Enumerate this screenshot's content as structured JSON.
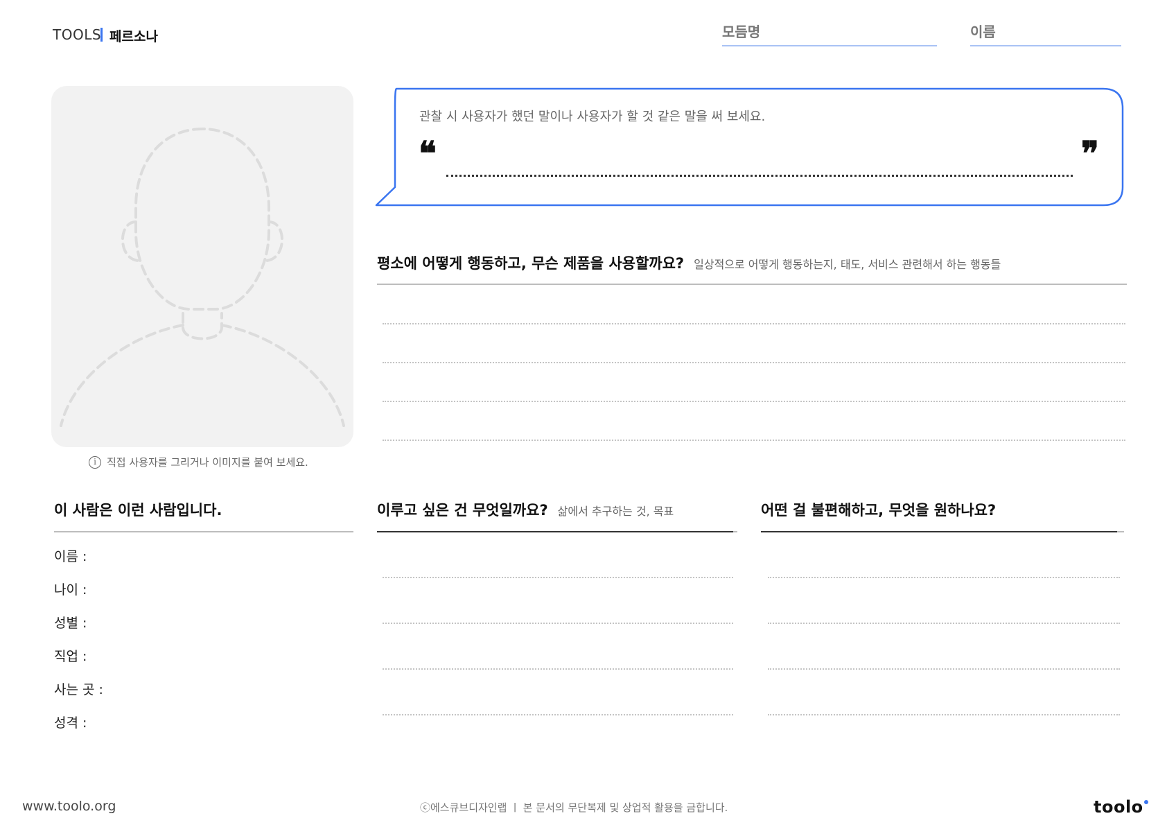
{
  "header": {
    "tools_label": "TOOLS",
    "page_title": "페르소나",
    "module_label": "모듬명",
    "name_label": "이름"
  },
  "photo": {
    "hint": "직접 사용자를 그리거나 이미지를 붙여 보세요."
  },
  "quote": {
    "prompt": "관찰 시 사용자가 했던 말이나 사용자가 할 것 같은 말을 써 보세요.",
    "open_mark": "❝",
    "close_mark": "❞"
  },
  "behavior": {
    "title": "평소에 어떻게 행동하고, 무슨 제품을 사용할까요?",
    "subtitle": "일상적으로 어떻게 행동하는지, 태도, 서비스 관련해서 하는 행동들"
  },
  "person": {
    "title": "이 사람은 이런 사람입니다.",
    "fields": [
      "이름 :",
      "나이 :",
      "성별 :",
      "직업 :",
      "사는 곳 :",
      "성격 :"
    ]
  },
  "goals": {
    "title": "이루고 싶은 건 무엇일까요?",
    "subtitle": "삶에서 추구하는 것, 목표"
  },
  "pains": {
    "title": "어떤 걸 불편해하고, 무엇을 원하나요?"
  },
  "footer": {
    "url": "www.toolo.org",
    "copyright": "ⓒ에스큐브디자인랩  ㅣ 본 문서의 무단복제 및 상업적 활용을 금합니다.",
    "logo": "toolo"
  },
  "colors": {
    "accent": "#3a75f0",
    "photo_bg": "#f2f2f2"
  }
}
